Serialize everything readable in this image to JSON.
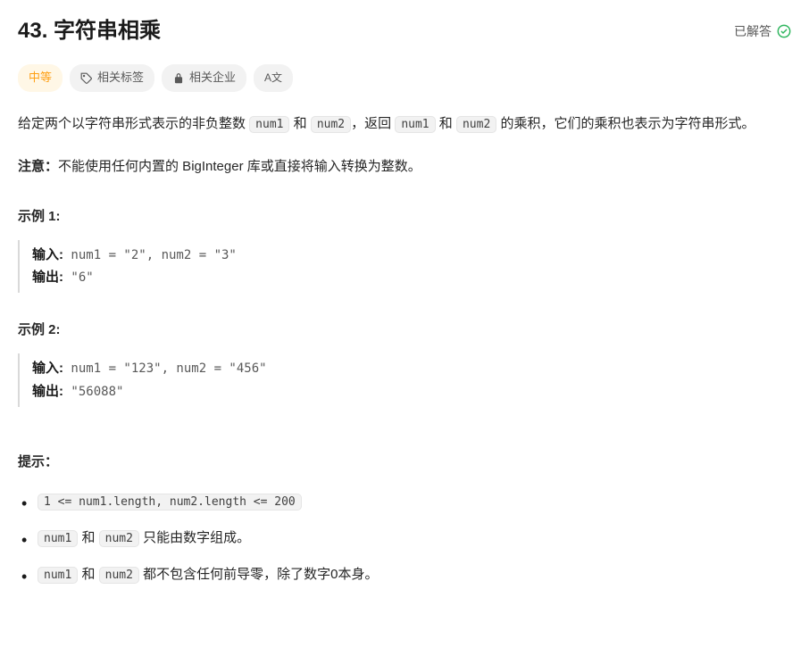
{
  "header": {
    "title": "43. 字符串相乘",
    "solved_label": "已解答"
  },
  "tags": {
    "difficulty": "中等",
    "topics": "相关标签",
    "companies": "相关企业",
    "translate": "A文"
  },
  "description": {
    "p1_a": "给定两个以字符串形式表示的非负整数 ",
    "p1_code1": "num1",
    "p1_b": " 和 ",
    "p1_code2": "num2",
    "p1_c": "，返回 ",
    "p1_code3": "num1",
    "p1_d": " 和 ",
    "p1_code4": "num2",
    "p1_e": " 的乘积，它们的乘积也表示为字符串形式。",
    "p2_strong": "注意：",
    "p2_text": "不能使用任何内置的 BigInteger 库或直接将输入转换为整数。"
  },
  "examples": {
    "ex1_heading": "示例 1:",
    "ex1_input_label": "输入:",
    "ex1_input_value": " num1 = \"2\", num2 = \"3\"",
    "ex1_output_label": "输出:",
    "ex1_output_value": " \"6\"",
    "ex2_heading": "示例 2:",
    "ex2_input_label": "输入:",
    "ex2_input_value": " num1 = \"123\", num2 = \"456\"",
    "ex2_output_label": "输出:",
    "ex2_output_value": " \"56088\""
  },
  "hints": {
    "heading": "提示：",
    "h1_code": "1 <= num1.length, num2.length <= 200",
    "h2_code1": "num1",
    "h2_mid": " 和 ",
    "h2_code2": "num2",
    "h2_text": " 只能由数字组成。",
    "h3_code1": "num1",
    "h3_mid": " 和 ",
    "h3_code2": "num2",
    "h3_text": " 都不包含任何前导零，除了数字0本身。"
  }
}
